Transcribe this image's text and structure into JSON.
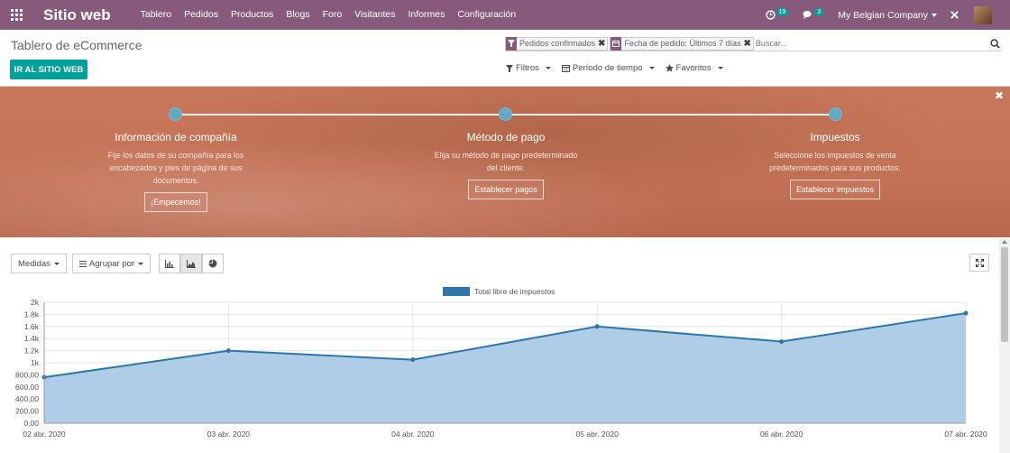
{
  "navbar": {
    "brand": "Sitio web",
    "menu": [
      "Tablero",
      "Pedidos",
      "Productos",
      "Blogs",
      "Foro",
      "Visitantes",
      "Informes",
      "Configuración"
    ],
    "activity_count": "19",
    "messages_count": "3",
    "company": "My Belgian Company"
  },
  "control": {
    "title": "Tablero de eCommerce",
    "go_button": "IR AL SITIO WEB",
    "facets": [
      "Pedidos confirmados",
      "Fecha de pedido: Últimos 7 días"
    ],
    "search_placeholder": "Buscar...",
    "filters_label": "Filtros",
    "period_label": "Período de tiempo",
    "favorites_label": "Favoritos"
  },
  "banner": {
    "steps": [
      {
        "title": "Información de compañía",
        "desc": "Fije los datos de su compañía para los encabezados y pies de página de sus documentos.",
        "button": "¡Empecemos!"
      },
      {
        "title": "Método de pago",
        "desc": "Elija su método de pago predeterminado del cliente.",
        "button": "Establecer pagos"
      },
      {
        "title": "Impuestos",
        "desc": "Seleccione los impuestos de venta predeterminados para sus productos.",
        "button": "Establecer impuestos"
      }
    ]
  },
  "graph_toolbar": {
    "measures": "Medidas",
    "group_by": "Agrupar por"
  },
  "colors": {
    "navbar": "#875a7b",
    "primary": "#00a09d",
    "series_line": "#2e76a8",
    "series_fill": "#a7c8e4"
  },
  "chart_data": {
    "type": "area",
    "legend": "Total libre de impuestos",
    "legend_position": "top-center",
    "x": [
      "02 abr. 2020",
      "03 abr. 2020",
      "04 abr. 2020",
      "05 abr. 2020",
      "06 abr. 2020",
      "07 abr. 2020"
    ],
    "series": [
      {
        "name": "Total libre de impuestos",
        "values": [
          760,
          1200,
          1050,
          1600,
          1350,
          1820
        ]
      }
    ],
    "ylim": [
      0,
      2000
    ],
    "yticks": [
      "0,00",
      "200,00",
      "400,00",
      "600,00",
      "800,00",
      "1k",
      "1.2k",
      "1.4k",
      "1.6k",
      "1.8k",
      "2k"
    ],
    "ytick_values": [
      0,
      200,
      400,
      600,
      800,
      1000,
      1200,
      1400,
      1600,
      1800,
      2000
    ],
    "grid": true
  }
}
